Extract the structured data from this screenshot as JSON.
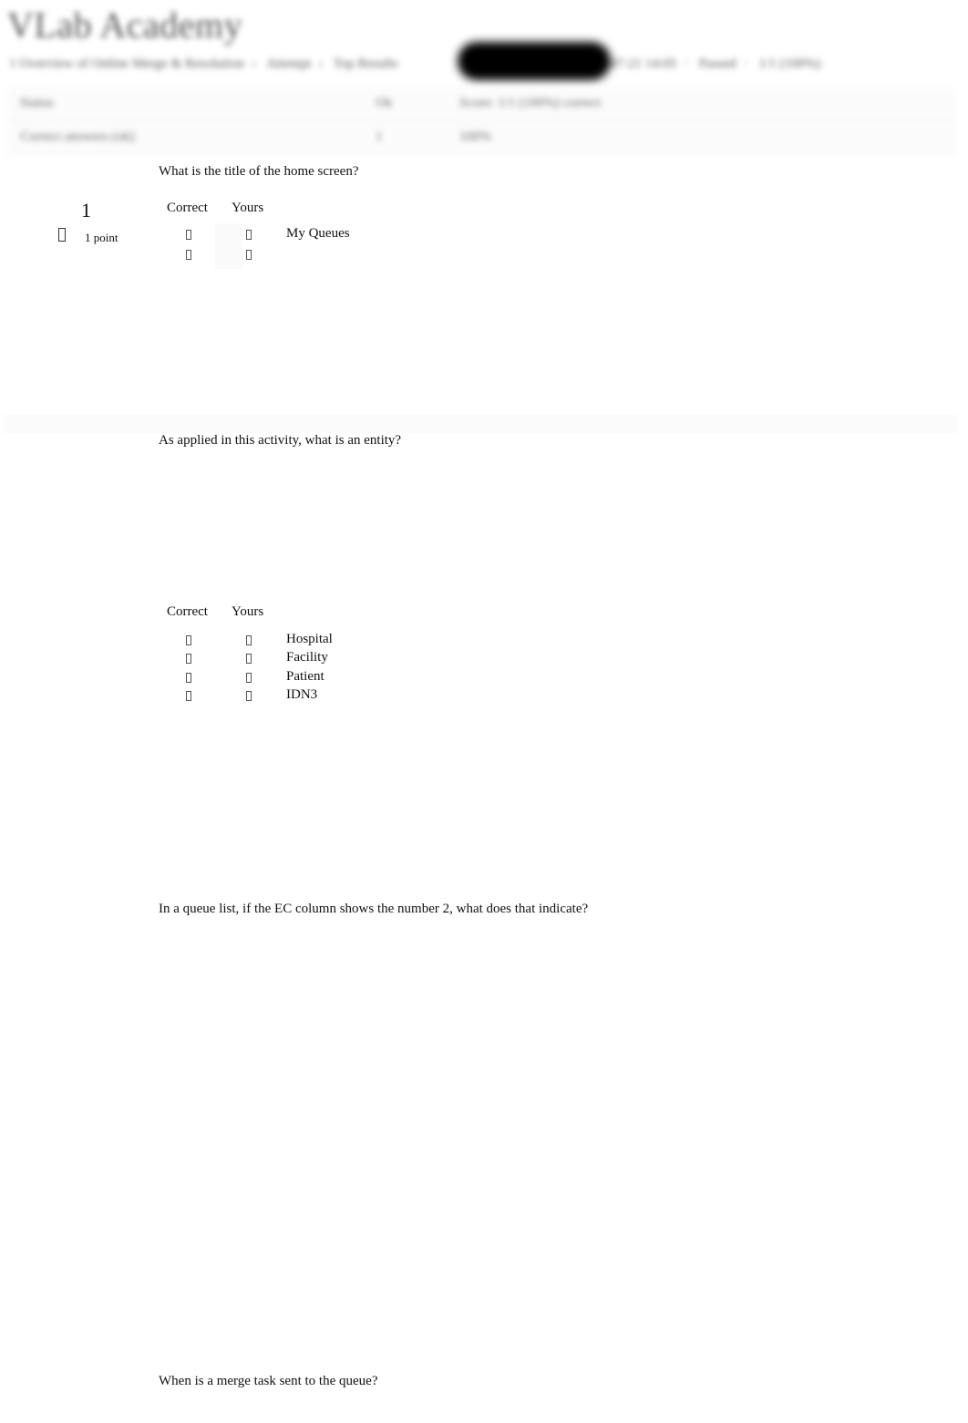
{
  "header": {
    "site_title": "VLab Academy",
    "breadcrumb": [
      "1 Overview of Online Merge & Resolution",
      "Attempt",
      "Top Results",
      "2019-07-21 14:05",
      "Passed",
      "1/1 (100%)"
    ]
  },
  "summary": {
    "rows": [
      {
        "label": "Status",
        "value": "Ok",
        "note": "Score: 1/1 (100%) correct"
      },
      {
        "label": "Correct answers (ok)",
        "value": "1",
        "note": "100%"
      }
    ]
  },
  "questions": [
    {
      "text": "What is the title of the home screen?",
      "number": "1",
      "points": "1 point",
      "columns": {
        "correct": "Correct",
        "yours": "Yours"
      },
      "options": [
        {
          "label": "My Queues"
        },
        {
          "label": ""
        }
      ]
    },
    {
      "text": "As applied in this activity, what is an entity?",
      "columns": {
        "correct": "Correct",
        "yours": "Yours"
      },
      "options": [
        {
          "label": "Hospital"
        },
        {
          "label": "Facility"
        },
        {
          "label": "Patient"
        },
        {
          "label": "IDN3"
        }
      ]
    },
    {
      "text": "In a queue list, if the EC column shows the number 2, what does that indicate?"
    },
    {
      "text": "When is a merge task sent to the queue?"
    }
  ],
  "icons": {
    "status": "missing-glyph-box",
    "option_marker": "missing-glyph-box"
  }
}
